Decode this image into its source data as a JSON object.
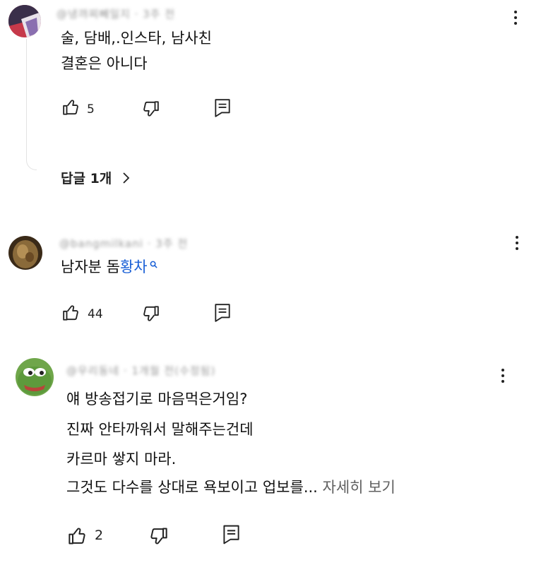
{
  "comments": [
    {
      "author": "@냉꺄찌빼일지 · 3주 전",
      "lines": [
        "술, 담배,.인스타, 남사친",
        "결혼은 아니다"
      ],
      "likes": "5",
      "replies_label": "답글 1개"
    },
    {
      "author": "@bangmilkani · 3주 전",
      "text_prefix": "남자분 돔",
      "search_term": "황차",
      "likes": "44"
    },
    {
      "author": "@우리동네 · 1개월 전(수정됨)",
      "lines": [
        "얘 방송접기로 마음먹은거임?",
        "진짜 안타까워서 말해주는건데",
        "카르마 쌓지 마라.",
        "그것도 다수를 상대로 욕보이고 업보를..."
      ],
      "read_more": "자세히 보기",
      "likes": "2"
    }
  ],
  "colors": {
    "link": "#1a60d6",
    "text": "#111111",
    "muted": "#606060"
  },
  "icons": [
    "thumbs-up-icon",
    "thumbs-down-icon",
    "reply-icon",
    "kebab-menu-icon",
    "chevron-right-icon",
    "search-icon"
  ]
}
